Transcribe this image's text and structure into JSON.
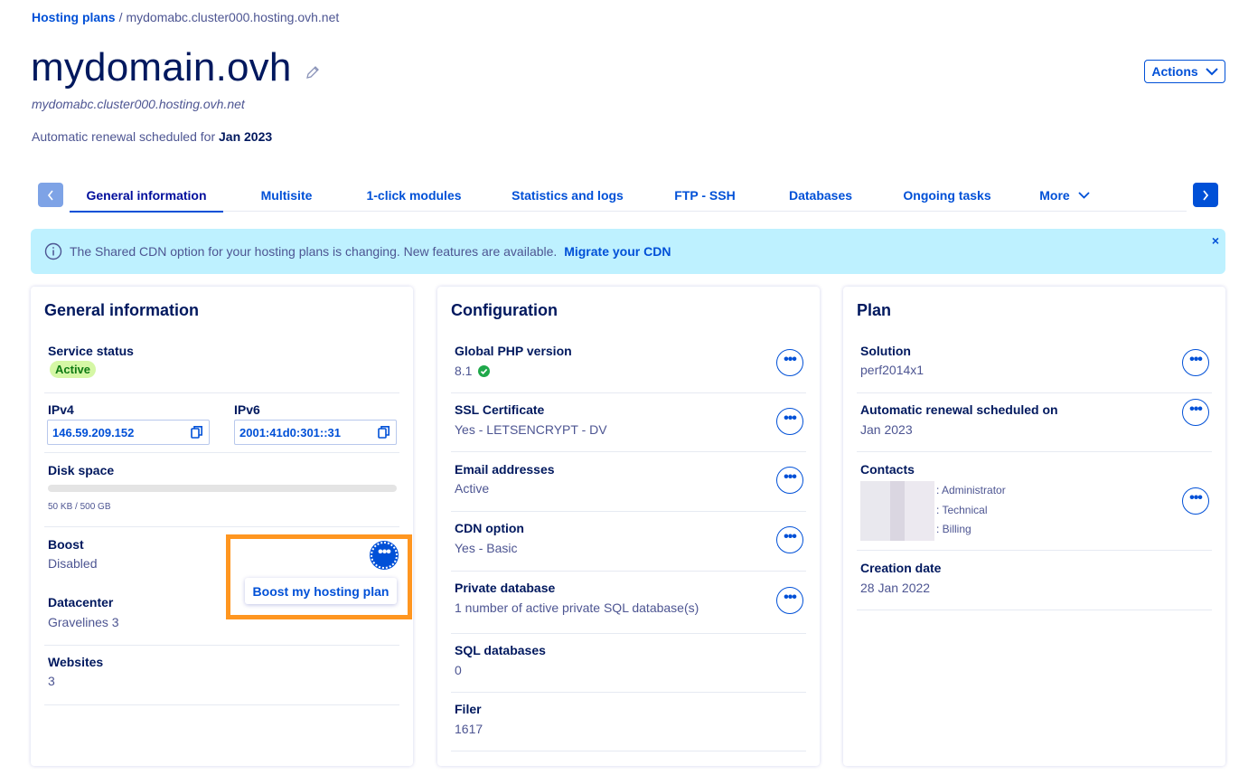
{
  "breadcrumb": {
    "link": "Hosting plans",
    "separator": "/",
    "current": "mydomabc.cluster000.hosting.ovh.net"
  },
  "header": {
    "title": "mydomain.ovh",
    "subtitle": "mydomabc.cluster000.hosting.ovh.net",
    "renewal_prefix": "Automatic renewal scheduled for",
    "renewal_date": "Jan 2023",
    "actions_label": "Actions"
  },
  "tabs": [
    {
      "label": "General information",
      "active": true
    },
    {
      "label": "Multisite"
    },
    {
      "label": "1-click modules"
    },
    {
      "label": "Statistics and logs"
    },
    {
      "label": "FTP - SSH"
    },
    {
      "label": "Databases"
    },
    {
      "label": "Ongoing tasks"
    },
    {
      "label": "More"
    }
  ],
  "banner": {
    "text": "The Shared CDN option for your hosting plans is changing. New features are available.",
    "link": "Migrate your CDN",
    "close": "×"
  },
  "general": {
    "title": "General information",
    "service_status_label": "Service status",
    "service_status_value": "Active",
    "ipv4_label": "IPv4",
    "ipv4_value": "146.59.209.152",
    "ipv6_label": "IPv6",
    "ipv6_value": "2001:41d0:301::31",
    "disk_label": "Disk space",
    "disk_usage_text": "50 KB / 500 GB",
    "disk_usage_fraction": 0.0001,
    "boost_label": "Boost",
    "boost_value": "Disabled",
    "boost_menu_item": "Boost my hosting plan",
    "datacenter_label": "Datacenter",
    "datacenter_value": "Gravelines 3",
    "websites_label": "Websites",
    "websites_value": "3"
  },
  "configuration": {
    "title": "Configuration",
    "php_label": "Global PHP version",
    "php_value": "8.1",
    "ssl_label": "SSL Certificate",
    "ssl_value": "Yes - LETSENCRYPT - DV",
    "email_label": "Email addresses",
    "email_value": "Active",
    "cdn_label": "CDN option",
    "cdn_value": "Yes - Basic",
    "private_db_label": "Private database",
    "private_db_value": "1 number of active private SQL database(s)",
    "sql_label": "SQL databases",
    "sql_value": "0",
    "filer_label": "Filer",
    "filer_value": "1617"
  },
  "plan": {
    "title": "Plan",
    "solution_label": "Solution",
    "solution_value": "perf2014x1",
    "renewal_label": "Automatic renewal scheduled on",
    "renewal_value": "Jan 2023",
    "contacts_label": "Contacts",
    "contact_roles": [
      ": Administrator",
      ": Technical",
      ": Billing"
    ],
    "creation_label": "Creation date",
    "creation_value": "28 Jan 2022"
  },
  "colors": {
    "primary": "#0050d7",
    "navy": "#00185e",
    "banner_bg": "#bef1ff",
    "highlight": "#ff9620",
    "active_badge": "#d5f7a5"
  },
  "icons": [
    "edit-icon",
    "chevron-down-icon",
    "chevron-left-icon",
    "chevron-right-icon",
    "info-icon",
    "close-icon",
    "copy-icon",
    "check-circle-icon",
    "more-icon"
  ]
}
